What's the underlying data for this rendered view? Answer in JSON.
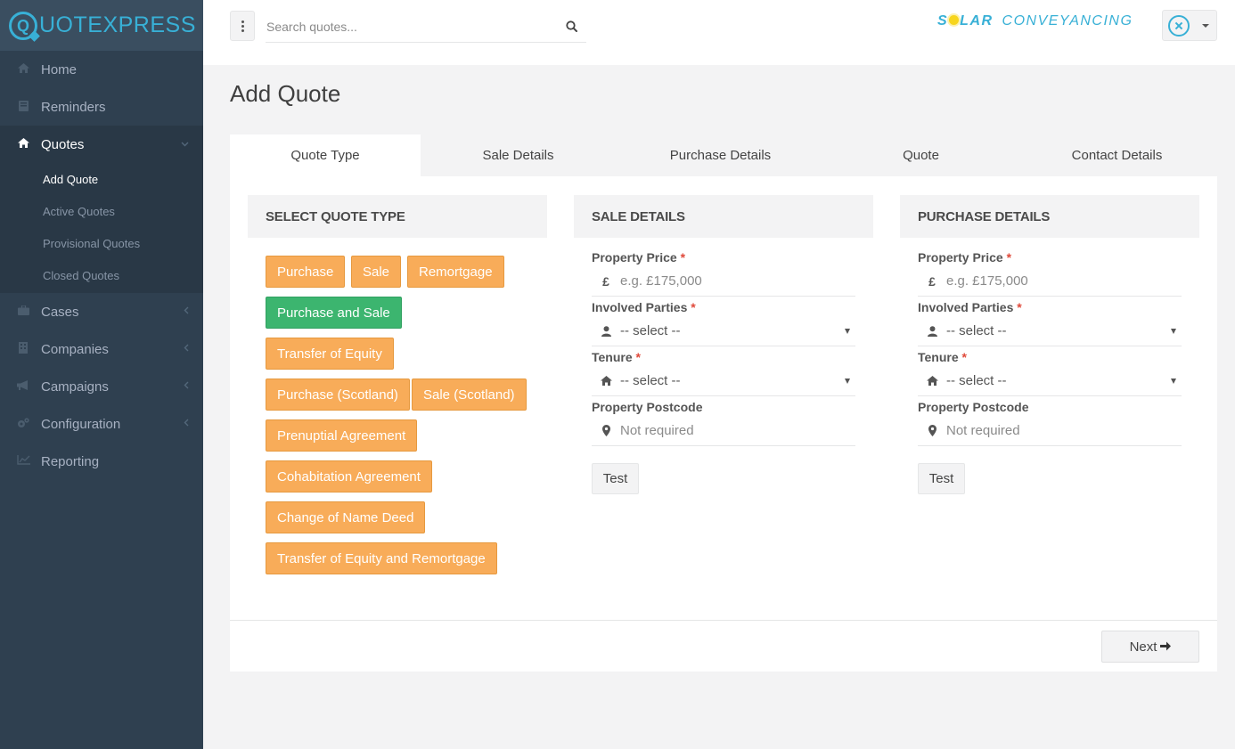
{
  "app": {
    "logo_mark": "Q",
    "logo_text": "UOTEXPRESS"
  },
  "sidebar": {
    "items": [
      {
        "label": "Home",
        "icon": "home-icon"
      },
      {
        "label": "Reminders",
        "icon": "book-icon"
      },
      {
        "label": "Quotes",
        "icon": "home-icon",
        "expanded": true,
        "children": [
          "Add Quote",
          "Active Quotes",
          "Provisional Quotes",
          "Closed Quotes"
        ],
        "current_child": "Add Quote"
      },
      {
        "label": "Cases",
        "icon": "briefcase-icon"
      },
      {
        "label": "Companies",
        "icon": "building-icon"
      },
      {
        "label": "Campaigns",
        "icon": "bullhorn-icon"
      },
      {
        "label": "Configuration",
        "icon": "gears-icon"
      },
      {
        "label": "Reporting",
        "icon": "line-chart-icon"
      }
    ]
  },
  "topbar": {
    "search_placeholder": "Search quotes...",
    "brand_s": "S",
    "brand_lar": "LAR",
    "brand_conveyancing": "CONVEYANCING"
  },
  "page": {
    "title": "Add Quote",
    "tabs": [
      "Quote Type",
      "Sale Details",
      "Purchase Details",
      "Quote",
      "Contact Details"
    ],
    "active_tab": "Quote Type"
  },
  "quote_type": {
    "heading": "SELECT QUOTE TYPE",
    "buttons": [
      "Purchase",
      "Sale",
      "Remortgage",
      "Purchase and Sale",
      "Transfer of Equity",
      "Purchase (Scotland)",
      "Sale (Scotland)",
      "Prenuptial Agreement",
      "Cohabitation Agreement",
      "Change of Name Deed",
      "Transfer of Equity and Remortgage"
    ],
    "selected": "Purchase and Sale"
  },
  "sale_details": {
    "heading": "SALE DETAILS",
    "price_label": "Property Price",
    "price_placeholder": "e.g. £175,000",
    "parties_label": "Involved Parties",
    "parties_value": "-- select --",
    "tenure_label": "Tenure",
    "tenure_value": "-- select --",
    "postcode_label": "Property Postcode",
    "postcode_placeholder": "Not required",
    "test_label": "Test"
  },
  "purchase_details": {
    "heading": "PURCHASE DETAILS",
    "price_label": "Property Price",
    "price_placeholder": "e.g. £175,000",
    "parties_label": "Involved Parties",
    "parties_value": "-- select --",
    "tenure_label": "Tenure",
    "tenure_value": "-- select --",
    "postcode_label": "Property Postcode",
    "postcode_placeholder": "Not required",
    "test_label": "Test"
  },
  "common": {
    "required_mark": "*",
    "currency_symbol": "£",
    "next_label": "Next"
  },
  "colors": {
    "sidebar_bg": "#2f4050",
    "accent": "#38b0d6",
    "warning_button": "#f8ac59",
    "selected_button": "#3cb56f",
    "required": "#e04a3b"
  }
}
